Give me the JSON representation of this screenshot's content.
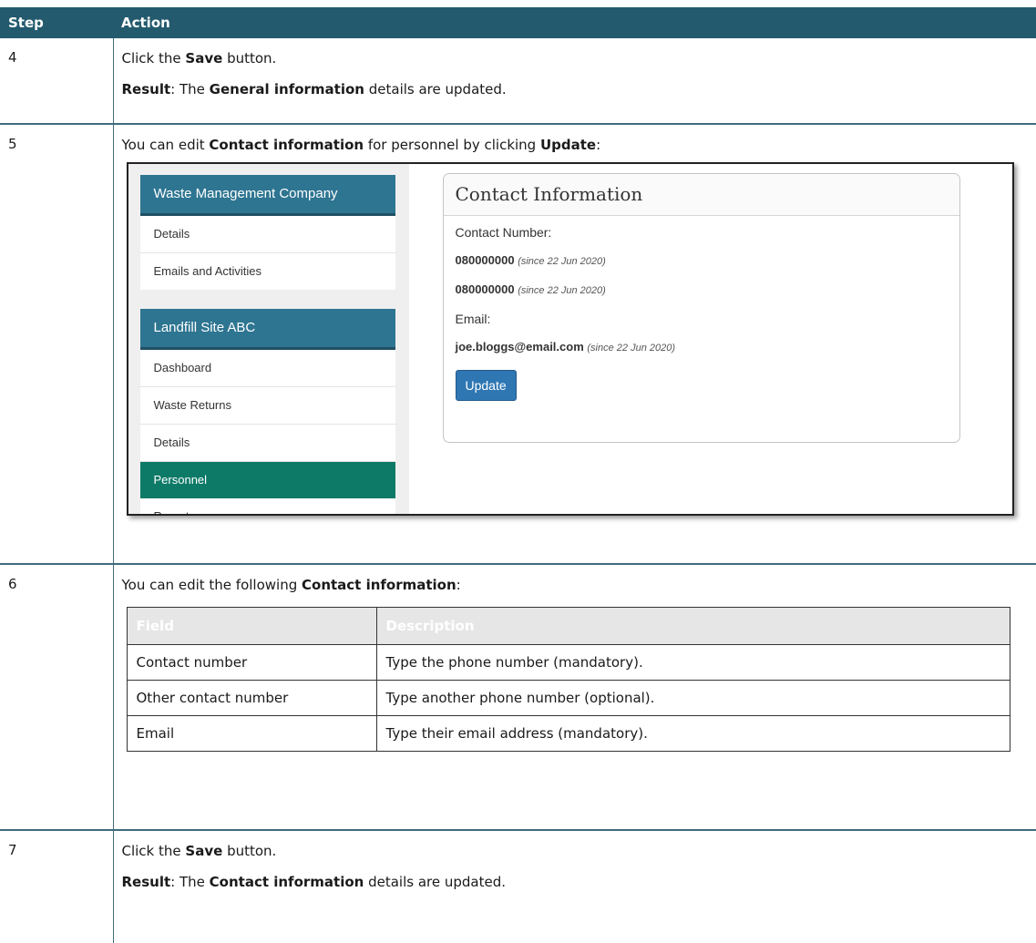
{
  "header": {
    "step": "Step",
    "action": "Action"
  },
  "rows": {
    "r4": {
      "step": "4",
      "l1": {
        "a": "Click the ",
        "b": "Save",
        "c": " button."
      },
      "l2": {
        "a": "Result",
        "b": ": The ",
        "c": "General information",
        "d": " details are updated."
      }
    },
    "r5": {
      "step": "5",
      "l1": {
        "a": "You can edit ",
        "b": "Contact information",
        "c": " for personnel by clicking ",
        "d": "Update",
        "e": ":"
      }
    },
    "r6": {
      "step": "6",
      "l1": {
        "a": "You can edit the following ",
        "b": "Contact information",
        "c": ":"
      }
    },
    "r7": {
      "step": "7",
      "l1": {
        "a": "Click the ",
        "b": "Save",
        "c": " button."
      },
      "l2": {
        "a": "Result",
        "b": ": The ",
        "c": "Contact information",
        "d": " details are updated."
      }
    }
  },
  "screenshot": {
    "panel1": {
      "title": "Waste Management Company",
      "items": [
        "Details",
        "Emails and Activities"
      ]
    },
    "panel2": {
      "title": "Landfill Site ABC",
      "items": [
        "Dashboard",
        "Waste Returns",
        "Details",
        "Personnel",
        "Reports"
      ],
      "active": "Personnel"
    },
    "card": {
      "title": "Contact Information",
      "contact_label": "Contact Number:",
      "numbers": [
        {
          "value": "080000000",
          "since": "(since 22 Jun 2020)"
        },
        {
          "value": "080000000",
          "since": "(since 22 Jun 2020)"
        }
      ],
      "email_label": "Email:",
      "email": {
        "value": "joe.bloggs@email.com",
        "since": "(since 22 Jun 2020)"
      },
      "update_label": "Update"
    }
  },
  "fields_table": {
    "headers": [
      "Field",
      "Description"
    ],
    "rows": [
      [
        "Contact number",
        "Type the phone number (mandatory)."
      ],
      [
        "Other contact number",
        "Type another phone number (optional)."
      ],
      [
        "Email",
        "Type their email address (mandatory)."
      ]
    ]
  },
  "colors": {
    "header_bg": "#235a6e",
    "panel_head": "#2e7591",
    "active_item": "#0d7a67",
    "button": "#2f77b3"
  }
}
